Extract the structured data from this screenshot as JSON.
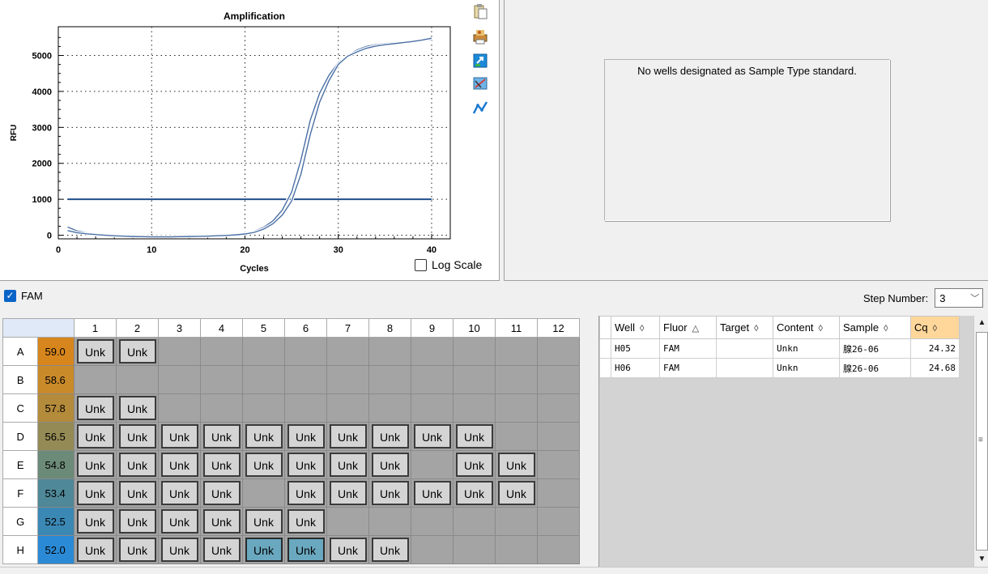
{
  "chart": {
    "title": "Amplification",
    "ylabel": "RFU",
    "xlabel": "Cycles",
    "log_scale_label": "Log Scale",
    "line_color": "#4a6fa5",
    "threshold_color": "#1f4e8c"
  },
  "chart_data": {
    "type": "line",
    "title": "Amplification",
    "xlabel": "Cycles",
    "ylabel": "RFU",
    "xlim": [
      0,
      42
    ],
    "ylim": [
      -100,
      5800
    ],
    "xticks": [
      0,
      10,
      20,
      30,
      40
    ],
    "yticks": [
      0,
      1000,
      2000,
      3000,
      4000,
      5000
    ],
    "grid": true,
    "threshold": 1000,
    "series": [
      {
        "x": [
          1,
          2,
          3,
          4,
          5,
          6,
          7,
          8,
          9,
          10,
          11,
          12,
          13,
          14,
          15,
          16,
          17,
          18,
          19,
          20,
          21,
          22,
          23,
          24,
          25,
          26,
          27,
          28,
          29,
          30,
          31,
          32,
          33,
          34,
          35,
          36,
          37,
          38,
          39,
          40
        ],
        "values": [
          230,
          120,
          70,
          40,
          20,
          0,
          -20,
          -30,
          -35,
          -40,
          -40,
          -40,
          -35,
          -30,
          -25,
          -20,
          -10,
          0,
          20,
          50,
          110,
          220,
          400,
          700,
          1200,
          2100,
          3200,
          3950,
          4450,
          4800,
          5000,
          5150,
          5250,
          5300,
          5330,
          5360,
          5380,
          5400,
          5420,
          5440
        ]
      },
      {
        "x": [
          1,
          2,
          3,
          4,
          5,
          6,
          7,
          8,
          9,
          10,
          11,
          12,
          13,
          14,
          15,
          16,
          17,
          18,
          19,
          20,
          21,
          22,
          23,
          24,
          25,
          26,
          27,
          28,
          29,
          30,
          31,
          32,
          33,
          34,
          35,
          36,
          37,
          38,
          39,
          40
        ],
        "values": [
          130,
          70,
          40,
          20,
          0,
          -15,
          -25,
          -35,
          -40,
          -45,
          -45,
          -45,
          -40,
          -35,
          -30,
          -25,
          -15,
          -5,
          10,
          35,
          80,
          170,
          320,
          560,
          950,
          1700,
          2800,
          3700,
          4300,
          4750,
          4980,
          5100,
          5200,
          5260,
          5300,
          5330,
          5360,
          5390,
          5430,
          5480
        ]
      }
    ]
  },
  "standards": {
    "message": "No wells designated as Sample Type standard."
  },
  "fluor_bar": {
    "fam_label": "FAM",
    "step_label": "Step Number:",
    "step_value": "3"
  },
  "plate": {
    "columns": [
      "1",
      "2",
      "3",
      "4",
      "5",
      "6",
      "7",
      "8",
      "9",
      "10",
      "11",
      "12"
    ],
    "rows": [
      {
        "label": "A",
        "temp": "59.0",
        "temp_color": "#d7861d",
        "wells": [
          "Unk",
          "Unk",
          "",
          "",
          "",
          "",
          "",
          "",
          "",
          "",
          "",
          ""
        ]
      },
      {
        "label": "B",
        "temp": "58.6",
        "temp_color": "#c98a2a",
        "wells": [
          "",
          "",
          "",
          "",
          "",
          "",
          "",
          "",
          "",
          "",
          "",
          ""
        ]
      },
      {
        "label": "C",
        "temp": "57.8",
        "temp_color": "#b48b3a",
        "wells": [
          "Unk",
          "Unk",
          "",
          "",
          "",
          "",
          "",
          "",
          "",
          "",
          "",
          ""
        ]
      },
      {
        "label": "D",
        "temp": "56.5",
        "temp_color": "#948a55",
        "wells": [
          "Unk",
          "Unk",
          "Unk",
          "Unk",
          "Unk",
          "Unk",
          "Unk",
          "Unk",
          "Unk",
          "Unk",
          "",
          ""
        ]
      },
      {
        "label": "E",
        "temp": "54.8",
        "temp_color": "#6c8a78",
        "wells": [
          "Unk",
          "Unk",
          "Unk",
          "Unk",
          "Unk",
          "Unk",
          "Unk",
          "Unk",
          "",
          "Unk",
          "Unk",
          ""
        ]
      },
      {
        "label": "F",
        "temp": "53.4",
        "temp_color": "#4f8898",
        "wells": [
          "Unk",
          "Unk",
          "Unk",
          "Unk",
          "",
          "Unk",
          "Unk",
          "Unk",
          "Unk",
          "Unk",
          "Unk",
          ""
        ]
      },
      {
        "label": "G",
        "temp": "52.5",
        "temp_color": "#3b88b5",
        "wells": [
          "Unk",
          "Unk",
          "Unk",
          "Unk",
          "Unk",
          "Unk",
          "",
          "",
          "",
          "",
          "",
          ""
        ]
      },
      {
        "label": "H",
        "temp": "52.0",
        "temp_color": "#2b8ad6",
        "wells": [
          "Unk",
          "Unk",
          "Unk",
          "Unk",
          "Unk*",
          "Unk*",
          "Unk",
          "Unk",
          "",
          "",
          "",
          ""
        ]
      }
    ]
  },
  "results": {
    "headers": [
      "Well",
      "Fluor",
      "Target",
      "Content",
      "Sample",
      "Cq"
    ],
    "sort_icons": [
      "◊",
      "△",
      "◊",
      "◊",
      "◊",
      "◊"
    ],
    "rows": [
      [
        "H05",
        "FAM",
        "",
        "Unkn",
        "腺26-06",
        "24.32"
      ],
      [
        "H06",
        "FAM",
        "",
        "Unkn",
        "腺26-06",
        "24.68"
      ]
    ]
  }
}
